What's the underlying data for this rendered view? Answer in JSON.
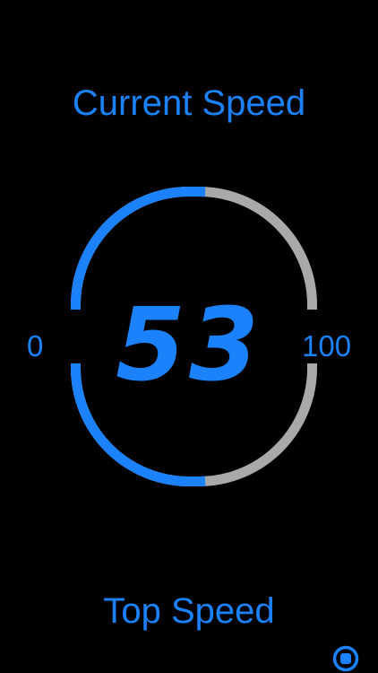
{
  "current_speed_title": "Current Speed",
  "top_speed_title": "Top Speed",
  "gauge": {
    "value": 53,
    "value_text": "53",
    "min": 0,
    "max": 100,
    "min_label": "0",
    "max_label": "100"
  },
  "colors": {
    "accent": "#1b82fc",
    "track": "#a9a9a9",
    "background": "#000000"
  },
  "icons": {
    "stop": "stop-circle-icon"
  }
}
